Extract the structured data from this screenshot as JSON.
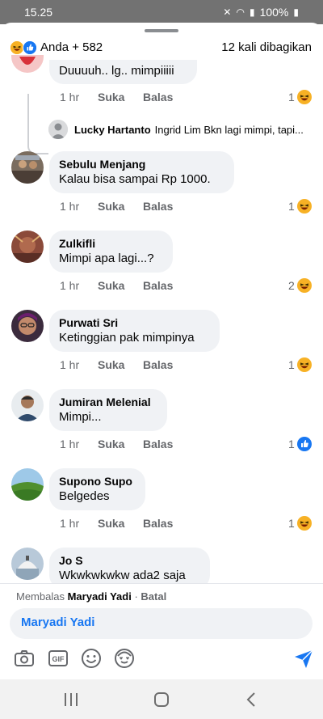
{
  "status_bar": {
    "time": "15.25",
    "battery": "100%"
  },
  "header": {
    "reaction_summary": "Anda + 582",
    "shares": "12 kali dibagikan"
  },
  "partial_comment": {
    "text": "Duuuuh.. lg.. mimpiiiii",
    "time": "1 hr",
    "like": "Suka",
    "reply": "Balas",
    "reaction_count": "1",
    "reaction": "haha-icon"
  },
  "reply_preview": {
    "name": "Lucky Hartanto",
    "text": "Ingrid Lim Bkn lagi mimpi, tapi..."
  },
  "comments": [
    {
      "name": "Sebulu Menjang",
      "text": "Kalau bisa sampai Rp 1000.",
      "time": "1 hr",
      "like": "Suka",
      "reply": "Balas",
      "reaction_count": "1",
      "reaction": "haha-icon"
    },
    {
      "name": "Zulkifli",
      "text": "Mimpi apa lagi...?",
      "time": "1 hr",
      "like": "Suka",
      "reply": "Balas",
      "reaction_count": "2",
      "reaction": "haha-icon"
    },
    {
      "name": "Purwati Sri",
      "text": "Ketinggian pak mimpinya",
      "time": "1 hr",
      "like": "Suka",
      "reply": "Balas",
      "reaction_count": "1",
      "reaction": "haha-icon"
    },
    {
      "name": "Jumiran Melenial",
      "text": "Mimpi...",
      "time": "1 hr",
      "like": "Suka",
      "reply": "Balas",
      "reaction_count": "1",
      "reaction": "like-icon"
    },
    {
      "name": "Supono Supo",
      "text": "Belgedes",
      "time": "1 hr",
      "like": "Suka",
      "reply": "Balas",
      "reaction_count": "1",
      "reaction": "haha-icon"
    },
    {
      "name": "Jo S",
      "text": "Wkwkwkwkw ada2 saja"
    }
  ],
  "composer": {
    "replying_prefix": "Membalas",
    "replying_to": "Maryadi Yadi",
    "separator": " · ",
    "cancel": "Batal",
    "input_value": "Maryadi Yadi",
    "tools": [
      "camera-icon",
      "gif-icon",
      "emoji-icon",
      "avatar-sticker-icon"
    ],
    "send": "send-icon"
  },
  "colors": {
    "accent": "#1877f2",
    "bubble": "#f0f2f5",
    "meta": "#65676b",
    "haha": "#f7b125"
  }
}
